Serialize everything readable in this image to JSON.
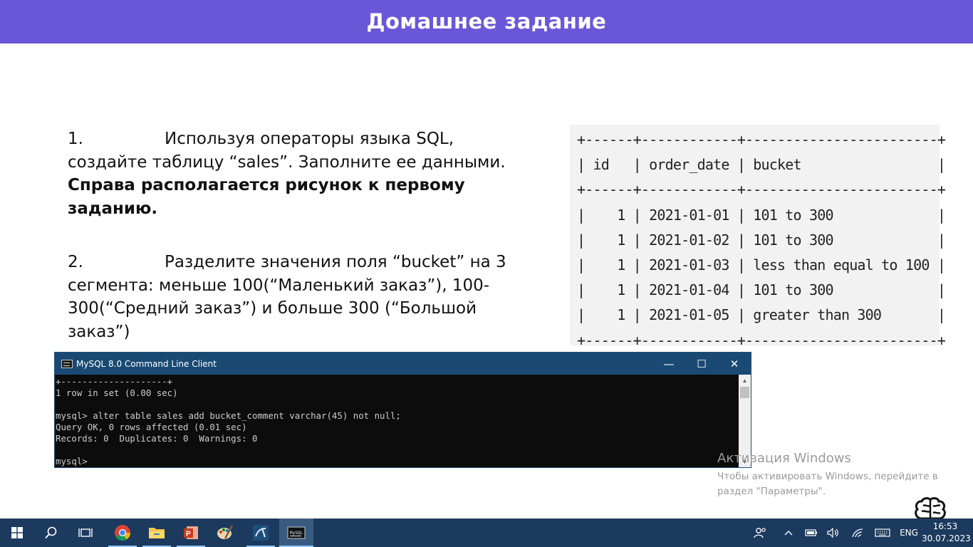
{
  "header": {
    "title": "Домашнее задание"
  },
  "task1": {
    "number": "1.",
    "text": "Используя операторы языка SQL,",
    "text2": "создайте таблицу “sales”. Заполните ее данными.",
    "bold": "Справа располагается рисунок к первому заданию."
  },
  "task2": {
    "number": "2.",
    "text": "Разделите  значения поля  “bucket” на 3",
    "text2": "сегмента: меньше 100(“Маленький заказ”), 100-300(“Средний заказ”) и больше 300 (“Большой заказ”)"
  },
  "figure": {
    "lines": [
      "+------+------------+------------------------+",
      "| id   | order_date | bucket                 |",
      "+------+------------+------------------------+",
      "|    1 | 2021-01-01 | 101 to 300             |",
      "|    1 | 2021-01-02 | 101 to 300             |",
      "|    1 | 2021-01-03 | less than equal to 100 |",
      "|    1 | 2021-01-04 | 101 to 300             |",
      "|    1 | 2021-01-05 | greater than 300       |",
      "+------+------------+------------------------+"
    ]
  },
  "console": {
    "title": "MySQL 8.0 Command Line Client",
    "minimize": "—",
    "maximize": "☐",
    "close": "✕",
    "lines": [
      "+--------------------+",
      "1 row in set (0.00 sec)",
      "",
      "mysql> alter table sales add bucket_comment varchar(45) not null;",
      "Query OK, 0 rows affected (0.01 sec)",
      "Records: 0  Duplicates: 0  Warnings: 0",
      "",
      "mysql>"
    ]
  },
  "activation": {
    "title": "Активация Windows",
    "line1": "Чтобы активировать Windows, перейдите в",
    "line2": "раздел \"Параметры\"."
  },
  "taskbar": {
    "apps": [
      "start-icon",
      "search-icon",
      "task-view-icon",
      "chrome-icon",
      "file-explorer-icon",
      "powerpoint-icon",
      "paint-icon",
      "mysql-workbench-icon",
      "mysql-console-icon"
    ],
    "language": "ENG",
    "time": "16:53",
    "date": "30.07.2023"
  },
  "colors": {
    "header": "#6a57d8",
    "taskbar": "#1c3a5e",
    "console_titlebar": "#1a4a73"
  }
}
